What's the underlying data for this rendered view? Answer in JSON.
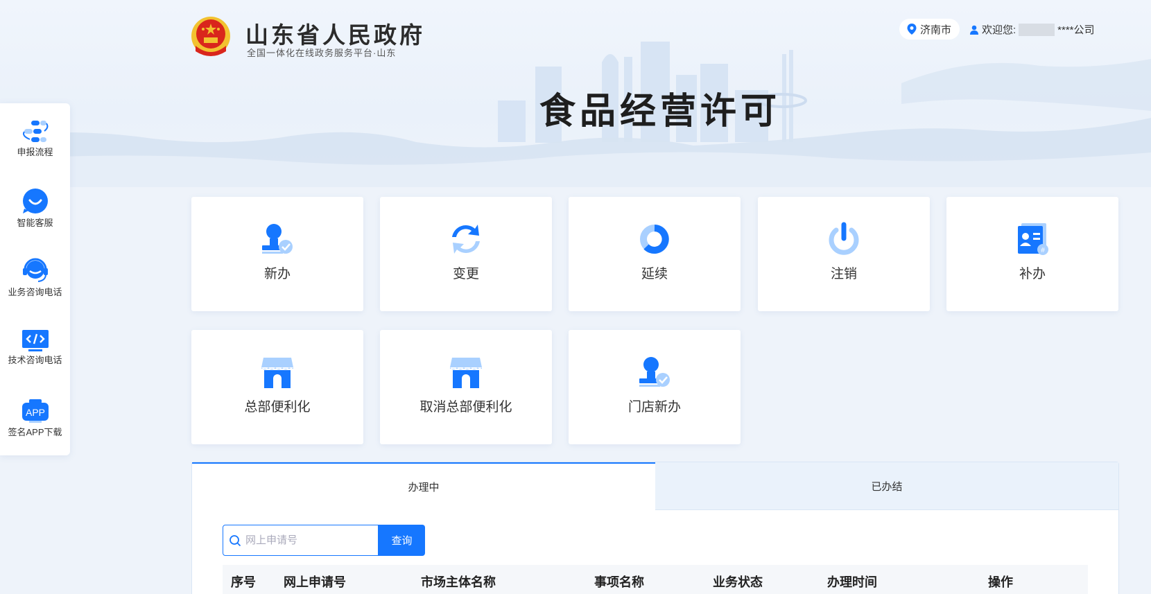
{
  "header": {
    "gov_title": "山东省人民政府",
    "gov_subtitle": "全国一体化在线政务服务平台·山东",
    "city": "济南市",
    "welcome_prefix": "欢迎您:",
    "welcome_suffix": "****公司",
    "page_heading": "食品经营许可",
    "location_icon": "location-pin-icon",
    "user_icon": "user-icon"
  },
  "sidebar": {
    "items": [
      {
        "label": "申报流程",
        "icon": "flow-icon"
      },
      {
        "label": "智能客服",
        "icon": "chat-bot-icon"
      },
      {
        "label": "业务咨询电话",
        "icon": "headset-icon"
      },
      {
        "label": "技术咨询电话",
        "icon": "code-monitor-icon"
      },
      {
        "label": "签名APP下载",
        "icon": "app-icon"
      }
    ]
  },
  "services": [
    {
      "label": "新办",
      "icon": "user-check-icon"
    },
    {
      "label": "变更",
      "icon": "refresh-icon"
    },
    {
      "label": "延续",
      "icon": "ring-icon"
    },
    {
      "label": "注销",
      "icon": "power-icon"
    },
    {
      "label": "补办",
      "icon": "id-card-icon"
    },
    {
      "label": "总部便利化",
      "icon": "store-icon"
    },
    {
      "label": "取消总部便利化",
      "icon": "store-icon"
    },
    {
      "label": "门店新办",
      "icon": "user-check-icon"
    }
  ],
  "tabs": [
    {
      "label": "办理中",
      "active": true
    },
    {
      "label": "已办结",
      "active": false
    }
  ],
  "search": {
    "placeholder": "网上申请号",
    "value": "",
    "button": "查询"
  },
  "table": {
    "columns": [
      "序号",
      "网上申请号",
      "市场主体名称",
      "事项名称",
      "业务状态",
      "办理时间",
      "操作"
    ]
  },
  "colors": {
    "accent": "#1677ff",
    "icon_light": "#a9d0ff",
    "emblem_red": "#d9261c",
    "emblem_gold": "#f2c230"
  }
}
